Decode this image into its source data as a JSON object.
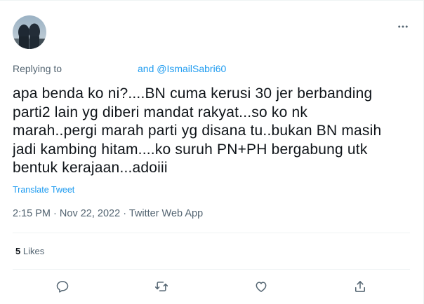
{
  "reply_context": {
    "prefix": "Replying to",
    "handles": "and @IsmailSabri60"
  },
  "tweet": {
    "lines": [
      "apa benda ko ni?....BN cuma kerusi 30 jer berbanding",
      "parti2 lain yg diberi mandat rakyat...so ko nk",
      "marah..pergi marah parti yg disana tu..bukan BN masih",
      "jadi kambing hitam....ko suruh PN+PH bergabung utk",
      "bentuk kerajaan...adoiii"
    ],
    "translate_label": "Translate Tweet",
    "time": "2:15 PM",
    "date": "Nov 22, 2022",
    "source": "Twitter Web App",
    "separator": "·"
  },
  "stats": {
    "likes_count": "5",
    "likes_label": "Likes"
  },
  "actions": [
    {
      "icon": "reply-icon"
    },
    {
      "icon": "retweet-icon"
    },
    {
      "icon": "like-icon"
    },
    {
      "icon": "share-icon"
    }
  ],
  "colors": {
    "text_primary": "#0f1419",
    "text_secondary": "#536471",
    "link": "#1d9bf0",
    "divider": "#eff3f4"
  }
}
